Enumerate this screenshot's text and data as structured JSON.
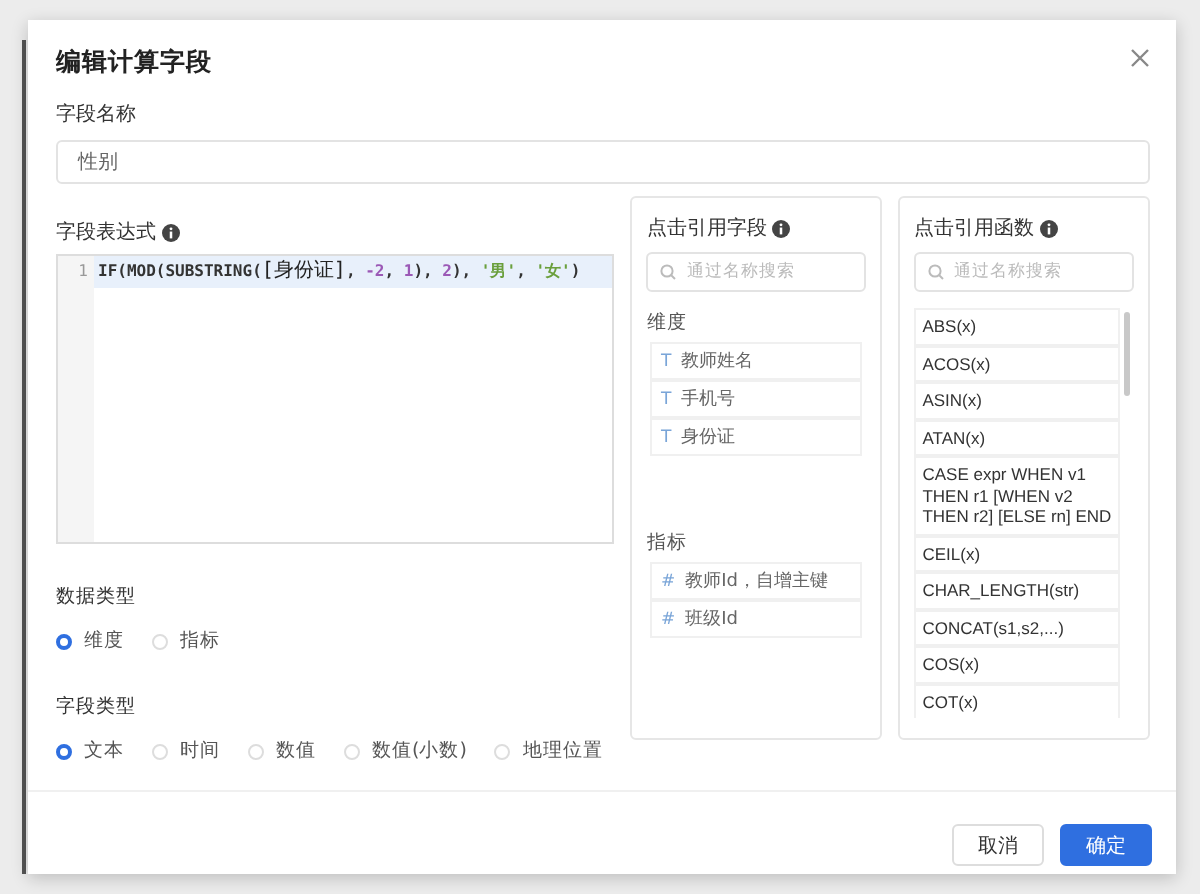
{
  "dialog": {
    "title": "编辑计算字段"
  },
  "field_name": {
    "label": "字段名称",
    "value": "性别"
  },
  "expression": {
    "label": "字段表达式",
    "line_number": "1",
    "tokens": [
      {
        "kind": "plain",
        "text": "IF(MOD(SUBSTRING("
      },
      {
        "kind": "field",
        "text": "[身份证]"
      },
      {
        "kind": "plain",
        "text": ", "
      },
      {
        "kind": "number",
        "text": "-2"
      },
      {
        "kind": "plain",
        "text": ", "
      },
      {
        "kind": "number",
        "text": "1"
      },
      {
        "kind": "plain",
        "text": "), "
      },
      {
        "kind": "number",
        "text": "2"
      },
      {
        "kind": "plain",
        "text": "), "
      },
      {
        "kind": "string",
        "text": "'男'"
      },
      {
        "kind": "plain",
        "text": ", "
      },
      {
        "kind": "string",
        "text": "'女'"
      },
      {
        "kind": "plain",
        "text": ")"
      }
    ]
  },
  "field_ref": {
    "title": "点击引用字段",
    "search": {
      "placeholder": "通过名称搜索"
    },
    "groups": [
      {
        "label": "维度",
        "items": [
          {
            "icon": "T",
            "text": "教师姓名"
          },
          {
            "icon": "T",
            "text": "手机号"
          },
          {
            "icon": "T",
            "text": "身份证"
          }
        ]
      },
      {
        "label": "指标",
        "items": [
          {
            "icon": "#",
            "text": "教师Id，自增主键"
          },
          {
            "icon": "#",
            "text": "班级Id"
          }
        ]
      }
    ]
  },
  "functions": {
    "title": "点击引用函数",
    "search": {
      "placeholder": "通过名称搜索"
    },
    "items": [
      "ABS(x)",
      "ACOS(x)",
      "ASIN(x)",
      "ATAN(x)",
      "CASE expr WHEN v1 THEN r1 [WHEN v2 THEN r2] [ELSE rn] END",
      "CEIL(x)",
      "CHAR_LENGTH(str)",
      "CONCAT(s1,s2,...)",
      "COS(x)",
      "COT(x)"
    ]
  },
  "data_type": {
    "label": "数据类型",
    "options": [
      {
        "label": "维度",
        "selected": true
      },
      {
        "label": "指标",
        "selected": false
      }
    ]
  },
  "field_type": {
    "label": "字段类型",
    "options": [
      {
        "label": "文本",
        "selected": true
      },
      {
        "label": "时间",
        "selected": false
      },
      {
        "label": "数值",
        "selected": false
      },
      {
        "label": "数值(小数)",
        "selected": false
      },
      {
        "label": "地理位置",
        "selected": false
      }
    ]
  },
  "buttons": [
    {
      "kind": "default",
      "label": "取消"
    },
    {
      "kind": "primary",
      "label": "确定"
    }
  ]
}
